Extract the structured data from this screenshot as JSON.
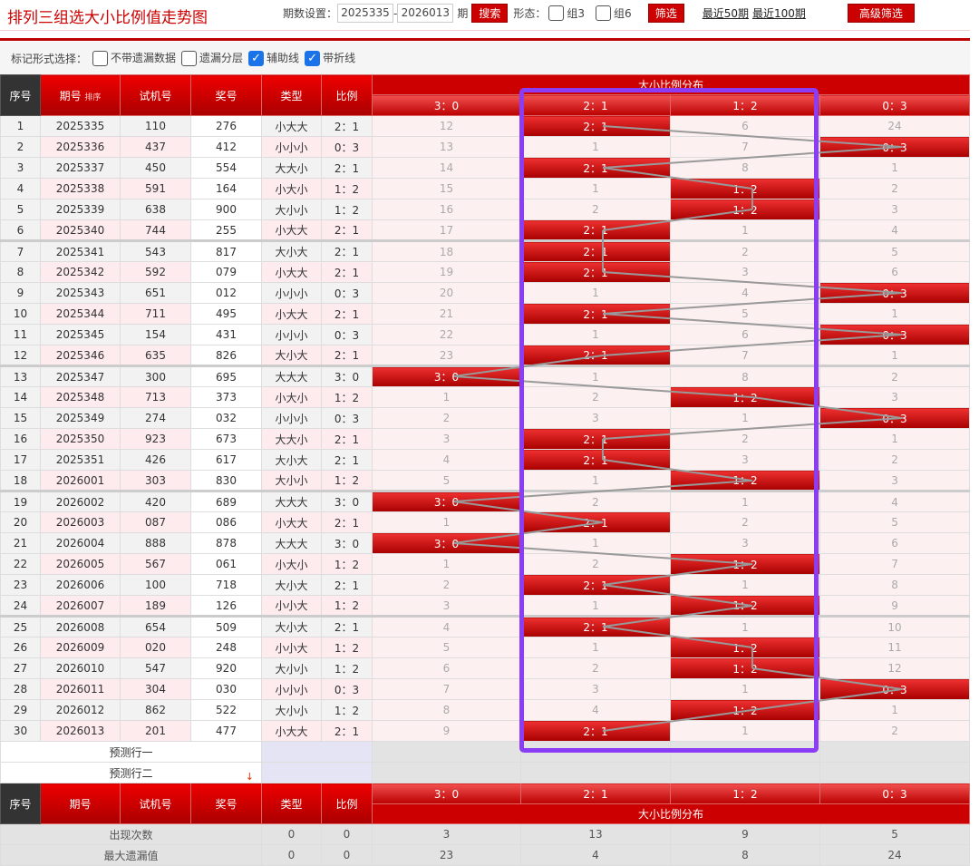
{
  "title": "排列三组选大小比例值走势图",
  "toolbar": {
    "period_label": "期数设置：",
    "from": "2025335",
    "dash": "-",
    "to": "2026013",
    "period_unit": "期",
    "search": "搜索",
    "form_label": "形态：",
    "group3": "组3",
    "group6": "组6",
    "filter": "筛选",
    "recent50": "最近50期",
    "recent100": "最近100期",
    "advanced": "高级筛选"
  },
  "options": {
    "label": "标记形式选择：",
    "items": [
      {
        "label": "不带遗漏数据",
        "checked": false
      },
      {
        "label": "遗漏分层",
        "checked": false
      },
      {
        "label": "辅助线",
        "checked": true
      },
      {
        "label": "带折线",
        "checked": true
      }
    ]
  },
  "headers": {
    "seq": "序号",
    "issue": "期号",
    "sort": "排序",
    "test": "试机号",
    "draw": "奖号",
    "type": "类型",
    "ratio": "比例",
    "dist": "大小比例分布",
    "dist_cols": [
      "3：0",
      "2：1",
      "1：2",
      "0：3"
    ]
  },
  "rows": [
    [
      "1",
      "2025335",
      "110",
      "276",
      "小大大",
      "2：1",
      [
        "12",
        "2：1",
        "6",
        "24"
      ]
    ],
    [
      "2",
      "2025336",
      "437",
      "412",
      "小小小",
      "0：3",
      [
        "13",
        "1",
        "7",
        "0：3"
      ]
    ],
    [
      "3",
      "2025337",
      "450",
      "554",
      "大大小",
      "2：1",
      [
        "14",
        "2：1",
        "8",
        "1"
      ]
    ],
    [
      "4",
      "2025338",
      "591",
      "164",
      "小大小",
      "1：2",
      [
        "15",
        "1",
        "1：2",
        "2"
      ]
    ],
    [
      "5",
      "2025339",
      "638",
      "900",
      "大小小",
      "1：2",
      [
        "16",
        "2",
        "1：2",
        "3"
      ]
    ],
    [
      "6",
      "2025340",
      "744",
      "255",
      "小大大",
      "2：1",
      [
        "17",
        "2：1",
        "1",
        "4"
      ]
    ],
    [
      "7",
      "2025341",
      "543",
      "817",
      "大小大",
      "2：1",
      [
        "18",
        "2：1",
        "2",
        "5"
      ]
    ],
    [
      "8",
      "2025342",
      "592",
      "079",
      "小大大",
      "2：1",
      [
        "19",
        "2：1",
        "3",
        "6"
      ]
    ],
    [
      "9",
      "2025343",
      "651",
      "012",
      "小小小",
      "0：3",
      [
        "20",
        "1",
        "4",
        "0：3"
      ]
    ],
    [
      "10",
      "2025344",
      "711",
      "495",
      "小大大",
      "2：1",
      [
        "21",
        "2：1",
        "5",
        "1"
      ]
    ],
    [
      "11",
      "2025345",
      "154",
      "431",
      "小小小",
      "0：3",
      [
        "22",
        "1",
        "6",
        "0：3"
      ]
    ],
    [
      "12",
      "2025346",
      "635",
      "826",
      "大小大",
      "2：1",
      [
        "23",
        "2：1",
        "7",
        "1"
      ]
    ],
    [
      "13",
      "2025347",
      "300",
      "695",
      "大大大",
      "3：0",
      [
        "3：0",
        "1",
        "8",
        "2"
      ]
    ],
    [
      "14",
      "2025348",
      "713",
      "373",
      "小大小",
      "1：2",
      [
        "1",
        "2",
        "1：2",
        "3"
      ]
    ],
    [
      "15",
      "2025349",
      "274",
      "032",
      "小小小",
      "0：3",
      [
        "2",
        "3",
        "1",
        "0：3"
      ]
    ],
    [
      "16",
      "2025350",
      "923",
      "673",
      "大大小",
      "2：1",
      [
        "3",
        "2：1",
        "2",
        "1"
      ]
    ],
    [
      "17",
      "2025351",
      "426",
      "617",
      "大小大",
      "2：1",
      [
        "4",
        "2：1",
        "3",
        "2"
      ]
    ],
    [
      "18",
      "2026001",
      "303",
      "830",
      "大小小",
      "1：2",
      [
        "5",
        "1",
        "1：2",
        "3"
      ]
    ],
    [
      "19",
      "2026002",
      "420",
      "689",
      "大大大",
      "3：0",
      [
        "3：0",
        "2",
        "1",
        "4"
      ]
    ],
    [
      "20",
      "2026003",
      "087",
      "086",
      "小大大",
      "2：1",
      [
        "1",
        "2：1",
        "2",
        "5"
      ]
    ],
    [
      "21",
      "2026004",
      "888",
      "878",
      "大大大",
      "3：0",
      [
        "3：0",
        "1",
        "3",
        "6"
      ]
    ],
    [
      "22",
      "2026005",
      "567",
      "061",
      "小大小",
      "1：2",
      [
        "1",
        "2",
        "1：2",
        "7"
      ]
    ],
    [
      "23",
      "2026006",
      "100",
      "718",
      "大小大",
      "2：1",
      [
        "2",
        "2：1",
        "1",
        "8"
      ]
    ],
    [
      "24",
      "2026007",
      "189",
      "126",
      "小小大",
      "1：2",
      [
        "3",
        "1",
        "1：2",
        "9"
      ]
    ],
    [
      "25",
      "2026008",
      "654",
      "509",
      "大小大",
      "2：1",
      [
        "4",
        "2：1",
        "1",
        "10"
      ]
    ],
    [
      "26",
      "2026009",
      "020",
      "248",
      "小小大",
      "1：2",
      [
        "5",
        "1",
        "1：2",
        "11"
      ]
    ],
    [
      "27",
      "2026010",
      "547",
      "920",
      "大小小",
      "1：2",
      [
        "6",
        "2",
        "1：2",
        "12"
      ]
    ],
    [
      "28",
      "2026011",
      "304",
      "030",
      "小小小",
      "0：3",
      [
        "7",
        "3",
        "1",
        "0：3"
      ]
    ],
    [
      "29",
      "2026012",
      "862",
      "522",
      "大小小",
      "1：2",
      [
        "8",
        "4",
        "1：2",
        "1"
      ]
    ],
    [
      "30",
      "2026013",
      "201",
      "477",
      "小大大",
      "2：1",
      [
        "9",
        "2：1",
        "1",
        "2"
      ]
    ]
  ],
  "predict": [
    "预测行一",
    "预测行二"
  ],
  "stats": [
    {
      "label": "出现次数",
      "values": [
        "0",
        "0",
        "3",
        "13",
        "9",
        "5"
      ]
    },
    {
      "label": "最大遗漏值",
      "values": [
        "0",
        "0",
        "23",
        "4",
        "8",
        "24"
      ]
    }
  ],
  "colors": {
    "accent": "#cc0000",
    "highlight_box": "#8b3cf5",
    "trend_line": "#999999"
  }
}
